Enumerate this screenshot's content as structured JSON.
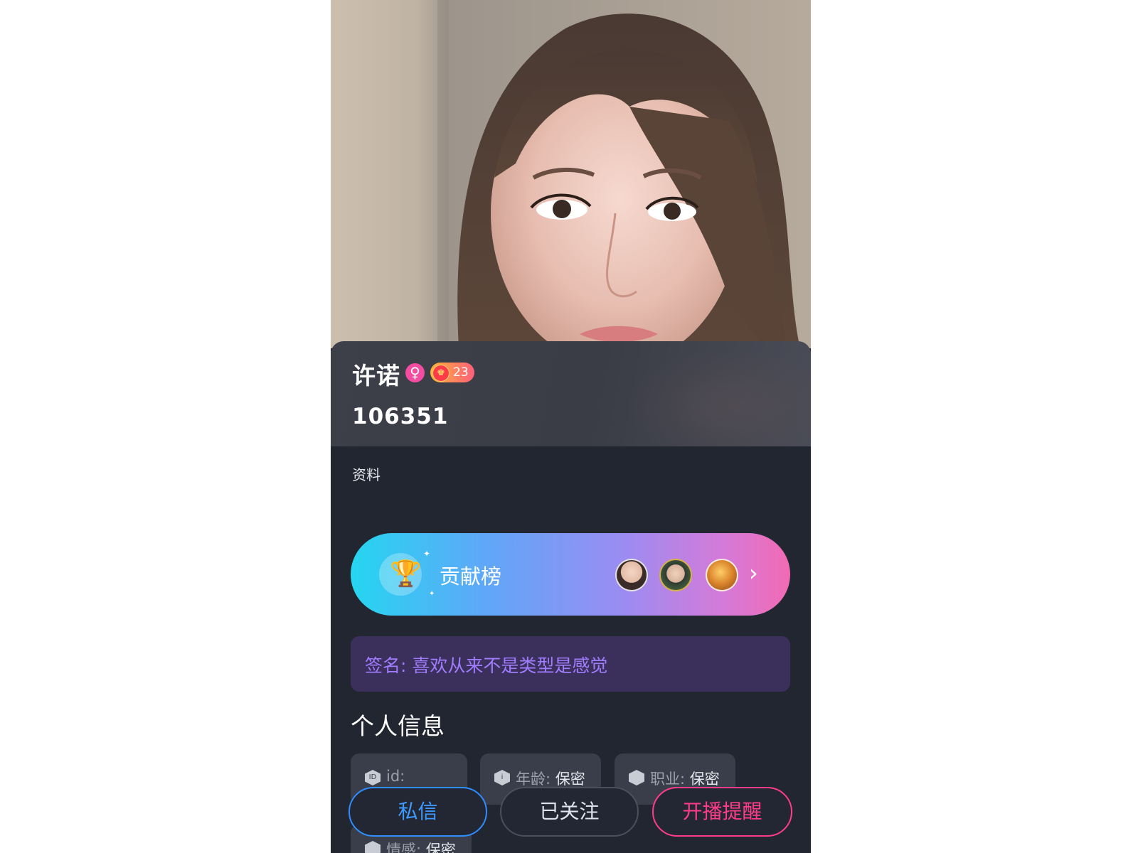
{
  "profile": {
    "name": "许诺",
    "gender_symbol": "♀",
    "level": "23",
    "user_id": "106351"
  },
  "tag_row": {
    "text": "资料"
  },
  "contribution": {
    "label": "贡献榜",
    "arrow": "›"
  },
  "signature": {
    "text": "签名: 喜欢从来不是类型是感觉"
  },
  "personal_info": {
    "title": "个人信息",
    "chips": [
      {
        "label": "id:",
        "value": ""
      },
      {
        "label": "年龄:",
        "value": "保密"
      },
      {
        "label": "职业:",
        "value": "保密"
      },
      {
        "label": "情感:",
        "value": "保密"
      }
    ]
  },
  "actions": {
    "message": "私信",
    "follow": "已关注",
    "remind": "开播提醒"
  },
  "colors": {
    "background": "#222630",
    "contribution_gradient_start": "#25d6f0",
    "contribution_gradient_end": "#f26ab4",
    "signature_text": "#a07cff",
    "message_accent": "#2f8dff",
    "remind_accent": "#ff3c8a"
  }
}
